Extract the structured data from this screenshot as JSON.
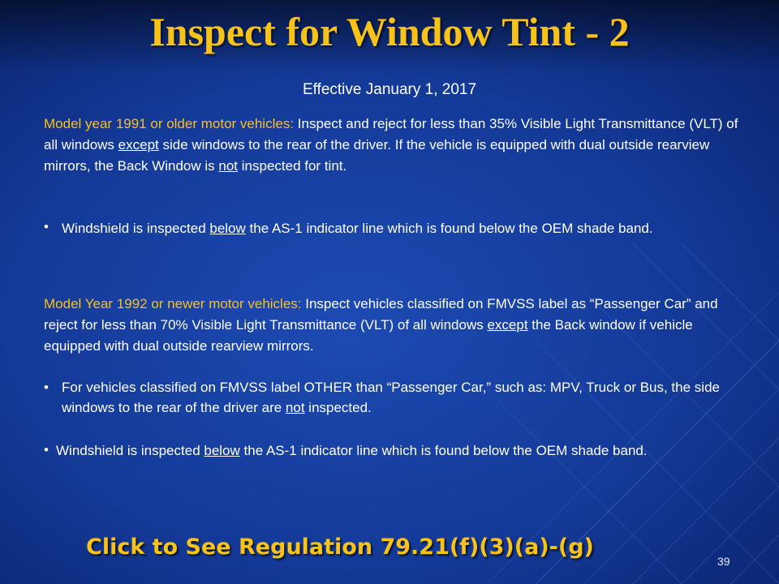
{
  "slide": {
    "title": "Inspect for Window Tint - 2",
    "subtitle": "Effective January 1, 2017",
    "section1": {
      "label": "Model year 1991 or older motor vehicles:",
      "text_a": " Inspect and reject for less than 35% Visible Light Transmittance (VLT) of all windows ",
      "text_u1": "except",
      "text_b": " side windows to the rear of the driver.   If the vehicle is equipped with dual outside rearview mirrors, the Back Window is ",
      "text_u2": "not",
      "text_c": " inspected for tint."
    },
    "bullet1": {
      "symbol": "•",
      "text_a": "Windshield is inspected ",
      "text_u": "below",
      "text_b": " the AS-1 indicator line which is found below the OEM shade band."
    },
    "section2": {
      "label": "Model Year 1992 or newer motor vehicles:",
      "text_a": " Inspect vehicles classified on FMVSS label as “Passenger Car” and reject for less than 70% Visible Light Transmittance (VLT) of all windows ",
      "text_u": "except",
      "text_b": " the Back window if vehicle equipped with dual outside rearview mirrors."
    },
    "bullet2": {
      "symbol": "•",
      "text_a": "For vehicles classified on FMVSS label OTHER than “Passenger Car,” such as: MPV, Truck or Bus, the side windows to the rear of the driver are ",
      "text_u": "not",
      "text_b": " inspected."
    },
    "bullet3": {
      "symbol": "•",
      "text_a": "Windshield is inspected ",
      "text_u": "below",
      "text_b": " the AS-1 indicator line which is found below the OEM shade band."
    },
    "link_label": "Click to See Regulation 79.21(f)(3)(a)-(g)",
    "page_number": "39"
  },
  "colors": {
    "accent_yellow": "#f7c21a",
    "background_blue": "#143a98",
    "text_white": "#ffffff"
  }
}
